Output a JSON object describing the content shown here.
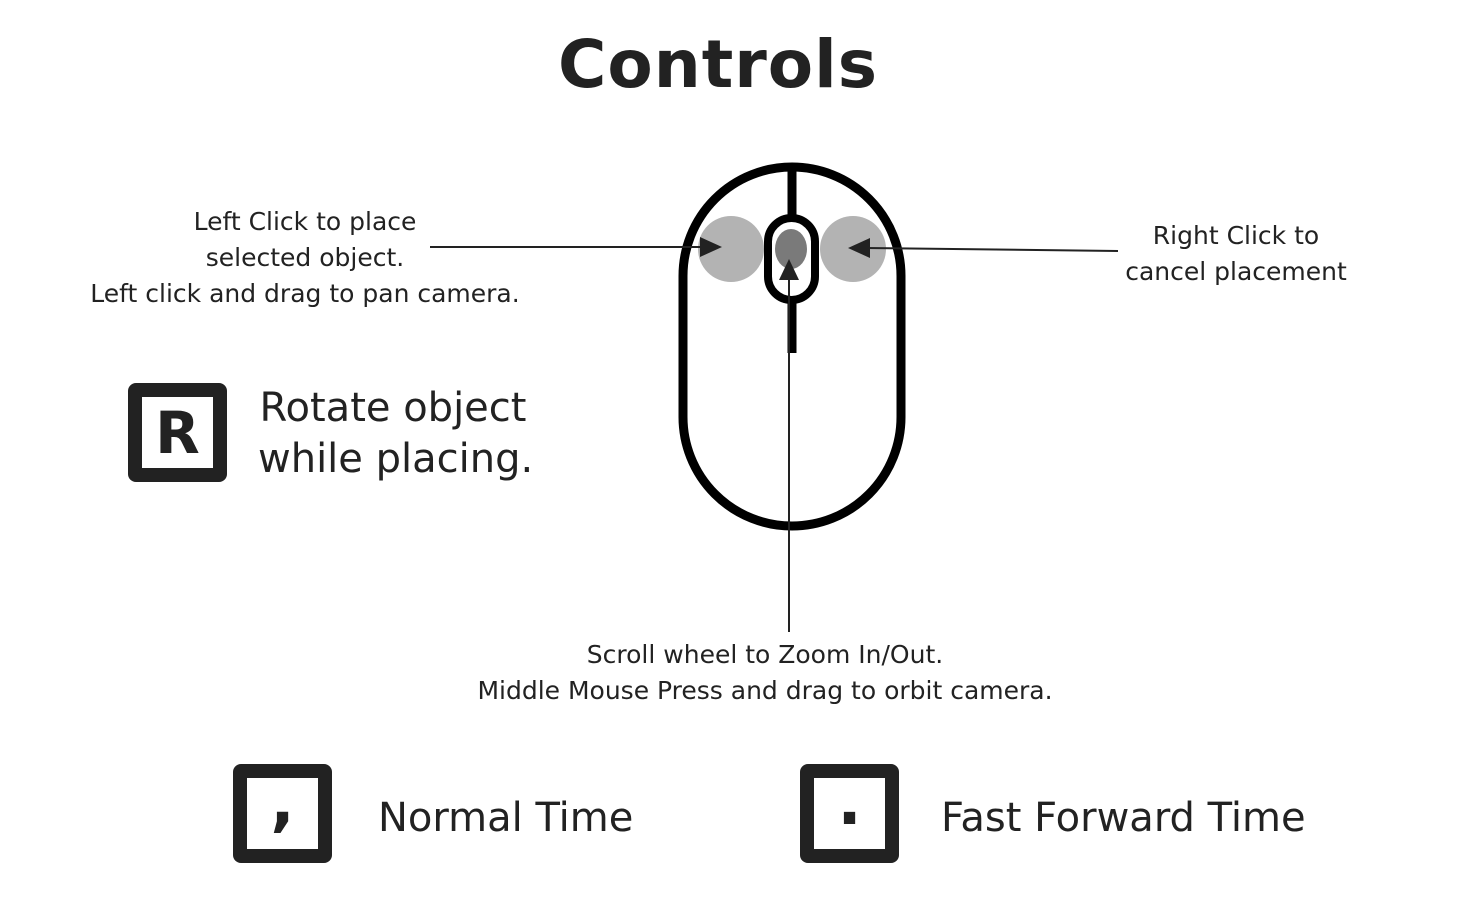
{
  "title": "Controls",
  "mouse": {
    "left_note": [
      "Left Click to place",
      "selected object.",
      "Left click and drag to pan camera."
    ],
    "right_note": [
      "Right Click to",
      "cancel placement"
    ],
    "bottom_note": [
      "Scroll wheel to Zoom In/Out.",
      "Middle Mouse Press and drag to orbit camera."
    ]
  },
  "keys": {
    "rotate": {
      "key": "R",
      "label": [
        "Rotate object",
        "while placing."
      ]
    },
    "normal": {
      "key": ",",
      "label": "Normal Time"
    },
    "fast": {
      "key": ".",
      "label": "Fast Forward Time"
    }
  },
  "colors": {
    "ink": "#222222",
    "button_highlight": "#b3b3b3",
    "wheel_highlight": "#7a7a7a",
    "background": "#ffffff"
  }
}
